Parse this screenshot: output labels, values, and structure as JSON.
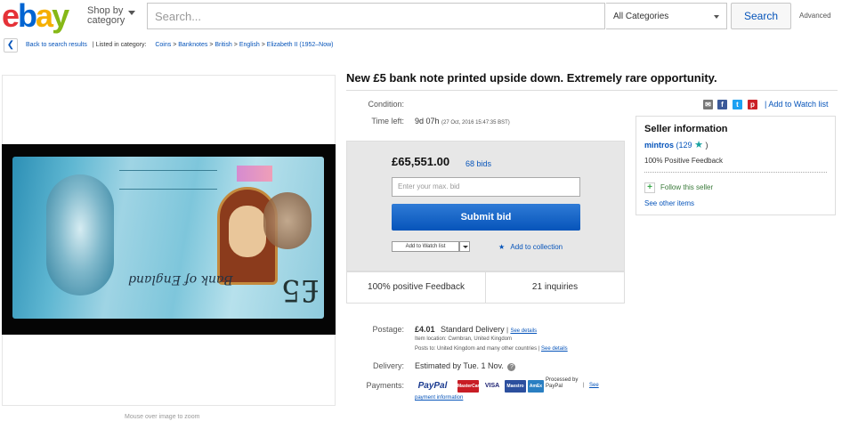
{
  "header": {
    "logo_letters": [
      "e",
      "b",
      "a",
      "y"
    ],
    "shop_by_line1": "Shop by",
    "shop_by_line2": "category",
    "search_placeholder": "Search...",
    "category_selected": "All Categories",
    "search_button": "Search",
    "advanced": "Advanced"
  },
  "breadcrumb": {
    "back": "Back to search results",
    "listed_in": "| Listed in category:",
    "items": [
      "Coins",
      "Banknotes",
      "British",
      "English",
      "Elizabeth II (1952–Now)"
    ],
    "separator": ">"
  },
  "listing": {
    "title": "New £5 bank note printed upside down. Extremely rare opportunity.",
    "caption": "Mouse over image to zoom",
    "condition_label": "Condition:",
    "time_left_label": "Time left:",
    "time_left_value": "9d 07h",
    "time_left_date": "(27 Oct, 2016   15:47:35 BST)",
    "share_icons": [
      "email-icon",
      "facebook-icon",
      "twitter-icon",
      "pinterest-icon"
    ],
    "add_to_watch_list": "| Add to Watch list",
    "price": "£65,551.00",
    "bids": "68 bids",
    "bid_placeholder": "Enter your max. bid",
    "submit_bid": "Submit bid",
    "watch_list_button": "Add to Watch list",
    "add_to_collection": "Add to collection",
    "positive_feedback": "100% positive Feedback",
    "inquiries": "21 inquiries"
  },
  "shipping": {
    "postage_label": "Postage:",
    "postage_price": "£4.01",
    "postage_method": "Standard Delivery",
    "see_details": "See details",
    "item_location": "Item location:  Cwmbran, United Kingdom",
    "posts_to": "Posts to:  United Kingdom and many other countries |",
    "see_details_2": "See details",
    "delivery_label": "Delivery:",
    "delivery_value": "Estimated by Tue. 1 Nov.",
    "payments_label": "Payments:",
    "payment_methods": [
      "PayPal",
      "MasterCard",
      "VISA",
      "Maestro",
      "AmEx"
    ],
    "processed_by": "Processed by PayPal",
    "see_payment": "See",
    "payment_information": "payment information"
  },
  "seller": {
    "title": "Seller information",
    "name": "mintros",
    "score_open": "(129",
    "score_close": ")",
    "feedback": "100% Positive Feedback",
    "follow": "Follow this seller",
    "other_items": "See other items"
  },
  "colors": {
    "ebay_red": "#e53238",
    "ebay_blue": "#0064d2",
    "ebay_yellow": "#f5af02",
    "ebay_green": "#86b817",
    "link_blue": "#0654ba"
  }
}
